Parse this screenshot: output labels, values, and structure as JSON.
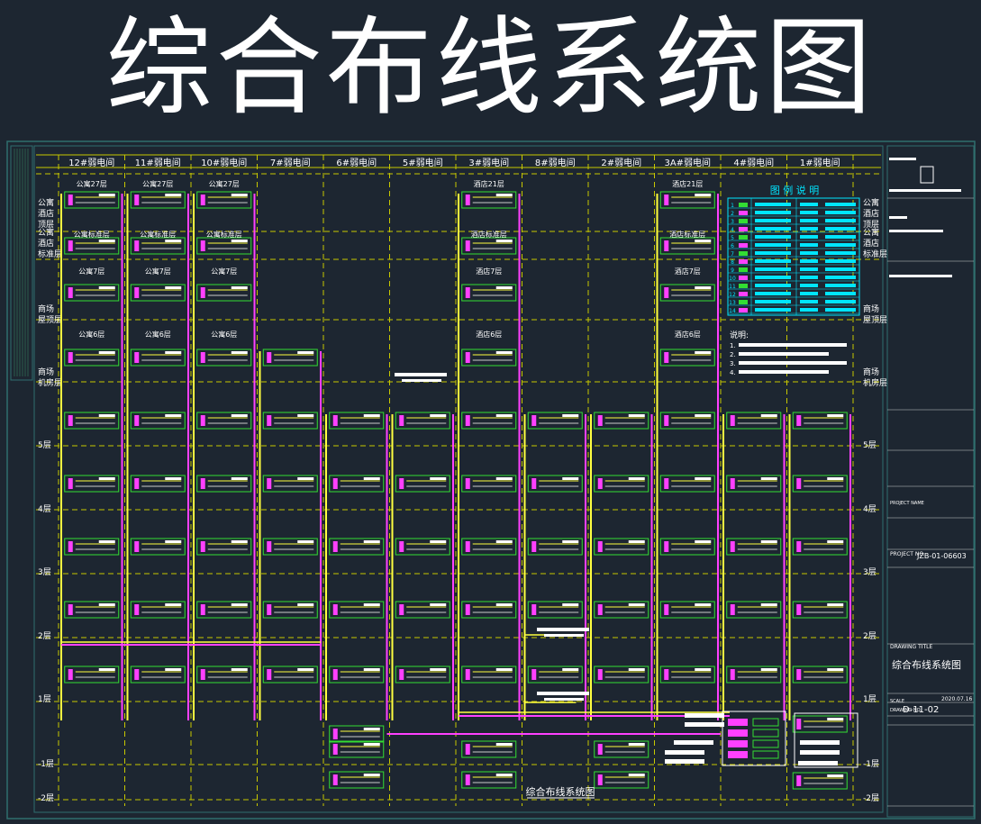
{
  "title": "综合布线系统图",
  "bottom_caption": "综合布线系统图",
  "columns": [
    "12#弱电间",
    "11#弱电间",
    "10#弱电间",
    "7#弱电间",
    "6#弱电间",
    "5#弱电间",
    "3#弱电间",
    "8#弱电间",
    "2#弱电间",
    "3A#弱电间",
    "4#弱电间",
    "1#弱电间"
  ],
  "floors_left": [
    "公寓\n酒店\n顶层",
    "公寓\n酒店\n标准层",
    "商场\n屋顶层",
    "商场\n机房层",
    "5层",
    "4层",
    "3层",
    "2层",
    "1层",
    "-1层",
    "-2层"
  ],
  "floors_right": [
    "公寓\n酒店\n顶层",
    "公寓\n酒店\n标准层",
    "商场\n屋顶层",
    "商场\n机房层",
    "5层",
    "4层",
    "3层",
    "2层",
    "1层",
    "-1层",
    "-2层"
  ],
  "zone_labels": {
    "c0": [
      "公寓27层",
      "公寓标准层",
      "公寓7层",
      "公寓6层"
    ],
    "c1": [
      "公寓27层",
      "公寓标准层",
      "公寓7层",
      "公寓6层"
    ],
    "c2": [
      "公寓27层",
      "公寓标准层",
      "公寓7层",
      "公寓6层"
    ],
    "c6": [
      "酒店21层",
      "酒店标准层",
      "酒店7层",
      "酒店6层"
    ],
    "c9": [
      "酒店21层",
      "酒店标准层",
      "酒店7层",
      "酒店6层"
    ]
  },
  "legend": {
    "title": "图 例 说 明",
    "row_numbers": [
      "1",
      "2",
      "3",
      "4",
      "5",
      "6",
      "7",
      "8",
      "9",
      "10",
      "11",
      "12",
      "13",
      "14"
    ]
  },
  "notes": {
    "title": "说明:",
    "items": [
      "1.",
      "2.",
      "3.",
      "4."
    ]
  },
  "title_block": {
    "drawing_title_label": "DRAWING TITLE",
    "drawing_title": "综合布线系统图",
    "project_no_label": "PROJECT NO.",
    "project_no": "JZB-01-06603",
    "drawing_no_label": "DRAWING NO.",
    "drawing_no": "D-11-02",
    "date": "2020.07.16",
    "project_name_label": "PROJECT NAME",
    "scale_label": "SCALE"
  },
  "colors": {
    "background": "#1d2631",
    "grid": "#c8c800",
    "border": "#2f6e6e",
    "riser": "#ff40ff",
    "riser2": "#ffff40",
    "panel": "#33dd33",
    "text": "#ffffff",
    "legend": "#00e5ff"
  }
}
